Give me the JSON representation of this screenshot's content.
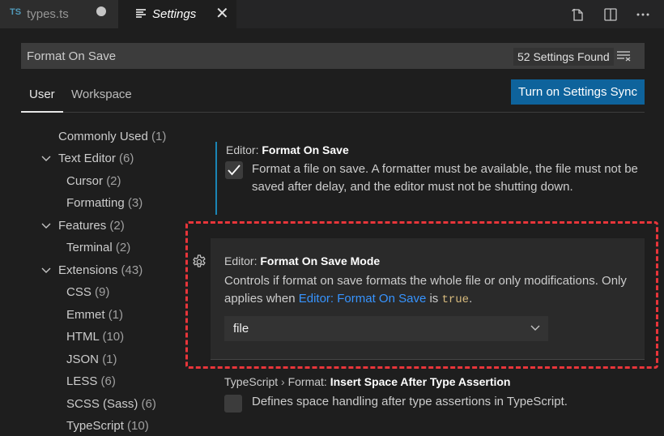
{
  "tabs": [
    {
      "icon": "TS",
      "label": "types.ts",
      "modified": true
    },
    {
      "label": "Settings",
      "active": true
    }
  ],
  "editor_actions": [
    "open-settings-json-icon",
    "split-editor-icon",
    "more-actions-icon"
  ],
  "search": {
    "value": "Format On Save",
    "result_count": "52 Settings Found"
  },
  "scope_tabs": {
    "user": "User",
    "workspace": "Workspace"
  },
  "sync_button": "Turn on Settings Sync",
  "toc": [
    {
      "label": "Commonly Used",
      "count": "(1)",
      "level": 0,
      "expandable": false
    },
    {
      "label": "Text Editor",
      "count": "(6)",
      "level": 0,
      "expandable": true
    },
    {
      "label": "Cursor",
      "count": "(2)",
      "level": 1
    },
    {
      "label": "Formatting",
      "count": "(3)",
      "level": 1
    },
    {
      "label": "Features",
      "count": "(2)",
      "level": 0,
      "expandable": true
    },
    {
      "label": "Terminal",
      "count": "(2)",
      "level": 1
    },
    {
      "label": "Extensions",
      "count": "(43)",
      "level": 0,
      "expandable": true
    },
    {
      "label": "CSS",
      "count": "(9)",
      "level": 1
    },
    {
      "label": "Emmet",
      "count": "(1)",
      "level": 1
    },
    {
      "label": "HTML",
      "count": "(10)",
      "level": 1
    },
    {
      "label": "JSON",
      "count": "(1)",
      "level": 1
    },
    {
      "label": "LESS",
      "count": "(6)",
      "level": 1
    },
    {
      "label": "SCSS (Sass)",
      "count": "(6)",
      "level": 1
    },
    {
      "label": "TypeScript",
      "count": "(10)",
      "level": 1
    }
  ],
  "settings": [
    {
      "category": "Editor: ",
      "name": "Format On Save",
      "checked": true,
      "description": "Format a file on save. A formatter must be available, the file must not be saved after delay, and the editor must not be shutting down."
    },
    {
      "category": "Editor: ",
      "name": "Format On Save Mode",
      "description_pre": "Controls if format on save formats the whole file or only modifications. Only applies when ",
      "description_link": "Editor: Format On Save",
      "description_mid": " is ",
      "description_code": "true",
      "description_post": ".",
      "value": "file"
    },
    {
      "category": "TypeScript",
      "separator": " › ",
      "subcategory": "Format: ",
      "name": "Insert Space After Type Assertion",
      "checked": false,
      "description": "Defines space handling after type assertions in TypeScript."
    }
  ],
  "colors": {
    "accent_button": "#0e639c",
    "link": "#3794ff",
    "highlight_border": "#e8353a",
    "modified_indicator": "#1a85b5"
  }
}
